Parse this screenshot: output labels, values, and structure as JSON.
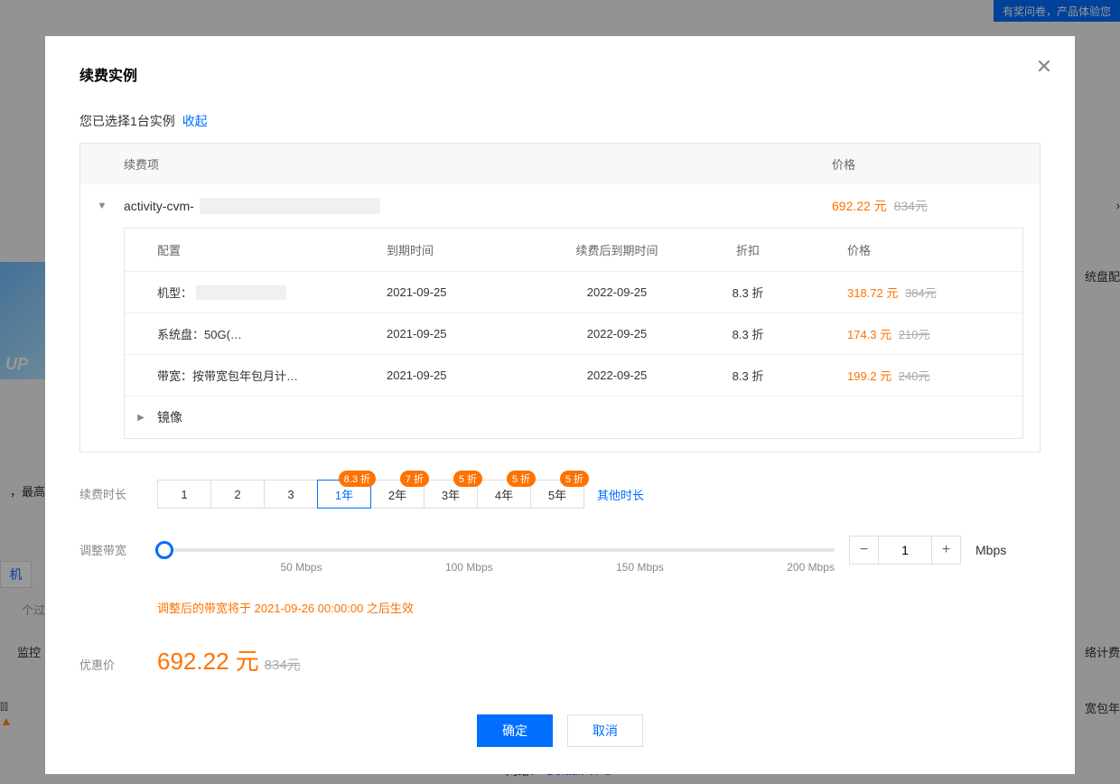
{
  "background": {
    "banner": "有奖问卷，产品体验您",
    "left_up": "UP",
    "left_text1": "，最高",
    "left_btn": "机",
    "left_text2": "个过",
    "left_text3": "监控",
    "right_text2": "统盘配",
    "right_text3": "络计费",
    "right_text4": "宽包年",
    "bottom_net_label": "网络：",
    "bottom_net_link": "Default-VPC"
  },
  "modal": {
    "title": "续费实例",
    "selected_prefix": "您已选择1台实例",
    "toggle": "收起",
    "header": {
      "item": "续费项",
      "price": "价格"
    },
    "instance": {
      "name": "activity-cvm-",
      "price": "692.22 元",
      "original": "834元"
    },
    "inner_header": {
      "config": "配置",
      "expire": "到期时间",
      "after": "续费后到期时间",
      "discount": "折扣",
      "price": "价格"
    },
    "rows": [
      {
        "config": "机型：",
        "redacted": true,
        "expire": "2021-09-25",
        "after": "2022-09-25",
        "disc": "8.3 折",
        "price": "318.72 元",
        "orig": "384元"
      },
      {
        "config": "系统盘：50G(…",
        "redacted": false,
        "expire": "2021-09-25",
        "after": "2022-09-25",
        "disc": "8.3 折",
        "price": "174.3 元",
        "orig": "210元"
      },
      {
        "config": "带宽：按带宽包年包月计…",
        "redacted": false,
        "expire": "2021-09-25",
        "after": "2022-09-25",
        "disc": "8.3 折",
        "price": "199.2 元",
        "orig": "240元"
      }
    ],
    "image_row": "镜像",
    "duration": {
      "label": "续费时长",
      "buttons": [
        {
          "label": "1",
          "badge": ""
        },
        {
          "label": "2",
          "badge": ""
        },
        {
          "label": "3",
          "badge": ""
        },
        {
          "label": "1年",
          "badge": "8.3 折",
          "active": true
        },
        {
          "label": "2年",
          "badge": "7 折"
        },
        {
          "label": "3年",
          "badge": "5 折"
        },
        {
          "label": "4年",
          "badge": "5 折"
        },
        {
          "label": "5年",
          "badge": "5 折"
        }
      ],
      "other": "其他时长"
    },
    "bandwidth": {
      "label": "调整带宽",
      "ticks": [
        "",
        "50 Mbps",
        "100 Mbps",
        "150 Mbps",
        "200 Mbps"
      ],
      "value": "1",
      "unit": "Mbps",
      "note": "调整后的带宽将于 2021-09-26 00:00:00 之后生效"
    },
    "final": {
      "label": "优惠价",
      "price": "692.22 元",
      "orig": "834元"
    },
    "footer": {
      "ok": "确定",
      "cancel": "取消"
    }
  }
}
